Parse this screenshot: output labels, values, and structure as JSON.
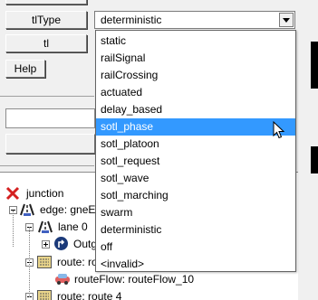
{
  "form": {
    "type_label": "tlType",
    "tl_label": "tl",
    "help_label": "Help",
    "tltype_value": "deterministic"
  },
  "dropdown": {
    "options": [
      "static",
      "railSignal",
      "railCrossing",
      "actuated",
      "delay_based",
      "sotl_phase",
      "sotl_platoon",
      "sotl_request",
      "sotl_wave",
      "sotl_marching",
      "swarm",
      "deterministic",
      "off",
      "<invalid>"
    ],
    "selected_index": 5
  },
  "tree": {
    "junction": "junction",
    "edge": "edge: gneE",
    "lane": "lane 0",
    "outgoing": "Outg",
    "route1": "route: ro",
    "routeflow": "routeFlow: routeFlow_10",
    "route2": "route: route 4"
  },
  "icons": {
    "junction": "junction-x-icon",
    "edge": "edge-icon",
    "lane": "lane-icon",
    "outgoing": "outgoing-arrow-icon",
    "route": "route-icon",
    "routeflow": "car-icon"
  },
  "colors": {
    "selection": "#3399ff",
    "junction_icon": "#d42020",
    "route_icon": "#e8d48a",
    "car_icon": "#e06060"
  }
}
